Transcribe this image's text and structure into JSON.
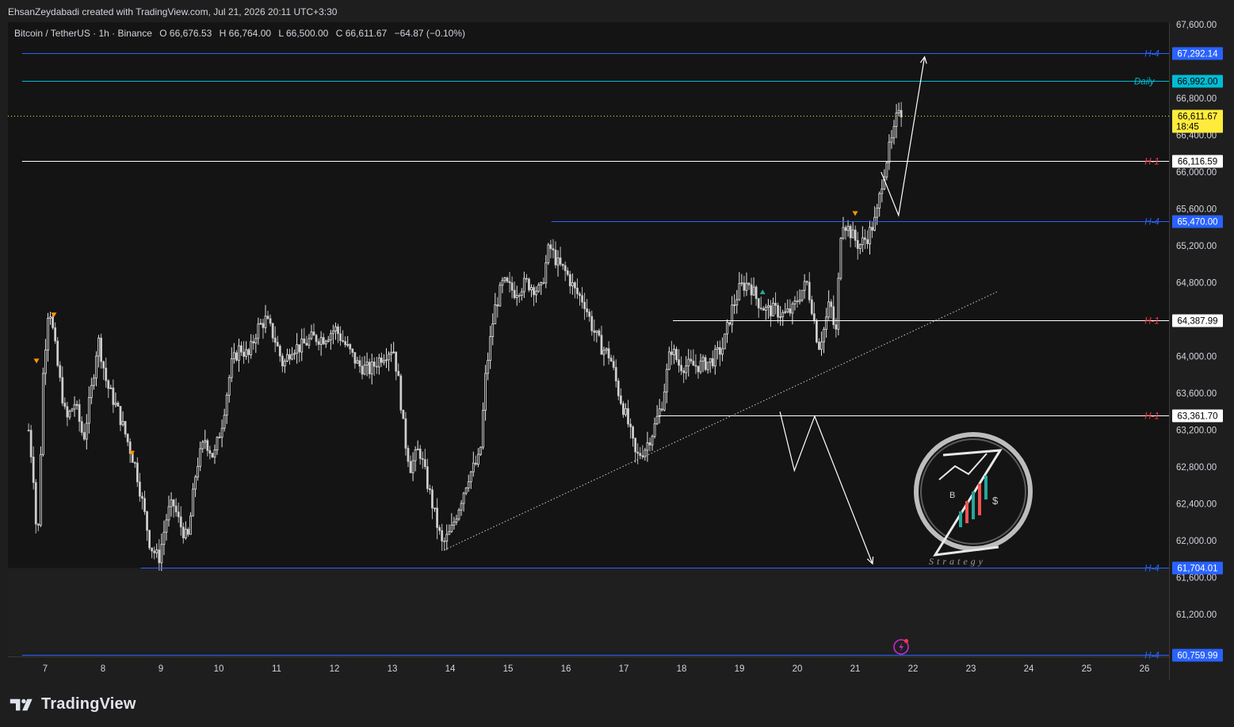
{
  "header": {
    "attribution": "EhsanZeydabadi created with TradingView.com, Jul 21, 2026 20:11 UTC+3:30"
  },
  "legend": {
    "symbol": "Bitcoin / TetherUS · 1h · Binance",
    "o_label": "O",
    "o_value": "66,676.53",
    "h_label": "H",
    "h_value": "66,764.00",
    "l_label": "L",
    "l_value": "66,500.00",
    "c_label": "C",
    "c_value": "66,611.67",
    "change": "−64.87 (−0.10%)"
  },
  "brand": {
    "name": "TradingView"
  },
  "watermark": {
    "caption": "Strategy"
  },
  "colors": {
    "background": "#141414",
    "price_bg": "#1e1e1e",
    "candle": "#d9d9d9",
    "h4_line": "#2962ff",
    "daily_line": "#00bcd4",
    "h1_line": "#ffffff",
    "h1_label": "#f23645",
    "current_price": "#ffeb3b",
    "marker_orange": "#ff9800",
    "marker_teal": "#26a69a"
  },
  "chart_data": {
    "type": "candlestick",
    "symbol": "Bitcoin / TetherUS",
    "interval": "1h",
    "exchange": "Binance",
    "x_axis": {
      "ticks": [
        {
          "label": "7",
          "day": 7
        },
        {
          "label": "8",
          "day": 8
        },
        {
          "label": "9",
          "day": 9
        },
        {
          "label": "10",
          "day": 10
        },
        {
          "label": "11",
          "day": 11
        },
        {
          "label": "12",
          "day": 12
        },
        {
          "label": "13",
          "day": 13
        },
        {
          "label": "14",
          "day": 14
        },
        {
          "label": "15",
          "day": 15
        },
        {
          "label": "16",
          "day": 16
        },
        {
          "label": "17",
          "day": 17
        },
        {
          "label": "18",
          "day": 18
        },
        {
          "label": "19",
          "day": 19
        },
        {
          "label": "20",
          "day": 20
        },
        {
          "label": "21",
          "day": 21
        },
        {
          "label": "22",
          "day": 22
        },
        {
          "label": "23",
          "day": 23
        },
        {
          "label": "24",
          "day": 24
        },
        {
          "label": "25",
          "day": 25
        },
        {
          "label": "26",
          "day": 26
        }
      ]
    },
    "y_axis": {
      "ticks": [
        {
          "label": "67,600.00",
          "value": 67600
        },
        {
          "label": "66,800.00",
          "value": 66800
        },
        {
          "label": "66,400.00",
          "value": 66400
        },
        {
          "label": "66,000.00",
          "value": 66000
        },
        {
          "label": "65,600.00",
          "value": 65600
        },
        {
          "label": "65,200.00",
          "value": 65200
        },
        {
          "label": "64,800.00",
          "value": 64800
        },
        {
          "label": "64,000.00",
          "value": 64000
        },
        {
          "label": "63,600.00",
          "value": 63600
        },
        {
          "label": "63,200.00",
          "value": 63200
        },
        {
          "label": "62,800.00",
          "value": 62800
        },
        {
          "label": "62,400.00",
          "value": 62400
        },
        {
          "label": "62,000.00",
          "value": 62000
        },
        {
          "label": "61,600.00",
          "value": 61600
        },
        {
          "label": "61,200.00",
          "value": 61200
        }
      ]
    },
    "price_path": [
      [
        6.7,
        63200
      ],
      [
        6.8,
        62600
      ],
      [
        6.85,
        61800
      ],
      [
        6.95,
        63800
      ],
      [
        7.05,
        64600
      ],
      [
        7.2,
        63900
      ],
      [
        7.35,
        63300
      ],
      [
        7.5,
        63500
      ],
      [
        7.65,
        63100
      ],
      [
        7.8,
        63700
      ],
      [
        7.9,
        64200
      ],
      [
        8.05,
        63700
      ],
      [
        8.25,
        63400
      ],
      [
        8.45,
        63000
      ],
      [
        8.55,
        62800
      ],
      [
        8.7,
        62300
      ],
      [
        8.8,
        61950
      ],
      [
        8.95,
        61800
      ],
      [
        9.1,
        62300
      ],
      [
        9.2,
        62400
      ],
      [
        9.3,
        62200
      ],
      [
        9.45,
        62000
      ],
      [
        9.6,
        62800
      ],
      [
        9.75,
        63100
      ],
      [
        9.9,
        62900
      ],
      [
        10.05,
        63300
      ],
      [
        10.2,
        63900
      ],
      [
        10.35,
        64100
      ],
      [
        10.5,
        64000
      ],
      [
        10.65,
        64300
      ],
      [
        10.8,
        64400
      ],
      [
        10.95,
        64200
      ],
      [
        11.1,
        63900
      ],
      [
        11.25,
        64100
      ],
      [
        11.4,
        64100
      ],
      [
        11.6,
        64200
      ],
      [
        11.8,
        64200
      ],
      [
        12.0,
        64300
      ],
      [
        12.2,
        64100
      ],
      [
        12.4,
        63900
      ],
      [
        12.6,
        63850
      ],
      [
        12.8,
        64000
      ],
      [
        13.0,
        64100
      ],
      [
        13.1,
        63700
      ],
      [
        13.2,
        63100
      ],
      [
        13.3,
        62800
      ],
      [
        13.45,
        63000
      ],
      [
        13.6,
        62600
      ],
      [
        13.75,
        62200
      ],
      [
        13.85,
        61950
      ],
      [
        14.0,
        62100
      ],
      [
        14.15,
        62400
      ],
      [
        14.3,
        62700
      ],
      [
        14.5,
        62900
      ],
      [
        14.6,
        63800
      ],
      [
        14.75,
        64500
      ],
      [
        14.9,
        64800
      ],
      [
        15.1,
        64700
      ],
      [
        15.3,
        64800
      ],
      [
        15.55,
        64700
      ],
      [
        15.7,
        65200
      ],
      [
        15.85,
        65000
      ],
      [
        16.0,
        64900
      ],
      [
        16.15,
        64700
      ],
      [
        16.3,
        64600
      ],
      [
        16.45,
        64300
      ],
      [
        16.6,
        64100
      ],
      [
        16.75,
        64000
      ],
      [
        16.9,
        63600
      ],
      [
        17.05,
        63300
      ],
      [
        17.2,
        62900
      ],
      [
        17.35,
        63000
      ],
      [
        17.5,
        63200
      ],
      [
        17.65,
        63500
      ],
      [
        17.8,
        64100
      ],
      [
        17.95,
        63900
      ],
      [
        18.1,
        63900
      ],
      [
        18.3,
        63900
      ],
      [
        18.5,
        63950
      ],
      [
        18.7,
        64100
      ],
      [
        18.85,
        64500
      ],
      [
        19.0,
        64750
      ],
      [
        19.15,
        64800
      ],
      [
        19.3,
        64600
      ],
      [
        19.45,
        64500
      ],
      [
        19.6,
        64500
      ],
      [
        19.75,
        64450
      ],
      [
        19.9,
        64500
      ],
      [
        20.05,
        64700
      ],
      [
        20.15,
        64800
      ],
      [
        20.25,
        64500
      ],
      [
        20.35,
        64100
      ],
      [
        20.45,
        64300
      ],
      [
        20.55,
        64600
      ],
      [
        20.65,
        64200
      ],
      [
        20.75,
        65500
      ],
      [
        20.85,
        65400
      ],
      [
        20.95,
        65300
      ],
      [
        21.05,
        65200
      ],
      [
        21.2,
        65300
      ],
      [
        21.35,
        65500
      ],
      [
        21.45,
        65900
      ],
      [
        21.55,
        66200
      ],
      [
        21.65,
        66400
      ],
      [
        21.75,
        66750
      ],
      [
        21.8,
        66611.67
      ]
    ],
    "levels": [
      {
        "label": "H-4",
        "value": 67292.14,
        "price_label": "67,292.14",
        "color": "#2962ff",
        "label_color": "#2962ff",
        "box_bg": "#2962ff",
        "box_fg": "#ffffff",
        "from_day": 6.6
      },
      {
        "label": "Daily",
        "value": 66992.0,
        "price_label": "66,992.00",
        "color": "#00bcd4",
        "label_color": "#00bcd4",
        "box_bg": "#00bcd4",
        "box_fg": "#000000",
        "from_day": 6.6
      },
      {
        "label": "H-1",
        "value": 66116.59,
        "price_label": "66,116.59",
        "color": "#ffffff",
        "label_color": "#f23645",
        "box_bg": "#ffffff",
        "box_fg": "#000000",
        "from_day": 6.6
      },
      {
        "label": "H-4",
        "value": 65470.0,
        "price_label": "65,470.00",
        "color": "#2962ff",
        "label_color": "#2962ff",
        "box_bg": "#2962ff",
        "box_fg": "#ffffff",
        "from_day": 15.75
      },
      {
        "label": "H-1",
        "value": 64387.99,
        "price_label": "64,387.99",
        "color": "#ffffff",
        "label_color": "#f23645",
        "box_bg": "#ffffff",
        "box_fg": "#000000",
        "from_day": 17.85
      },
      {
        "label": "H-1",
        "value": 63361.7,
        "price_label": "63,361.70",
        "color": "#ffffff",
        "label_color": "#f23645",
        "box_bg": "#ffffff",
        "box_fg": "#000000",
        "from_day": 17.6
      },
      {
        "label": "H-4",
        "value": 61704.01,
        "price_label": "61,704.01",
        "color": "#2962ff",
        "label_color": "#2962ff",
        "box_bg": "#2962ff",
        "box_fg": "#ffffff",
        "from_day": 8.65
      },
      {
        "label": "H-4",
        "value": 60759.99,
        "price_label": "60,759.99",
        "color": "#2962ff",
        "label_color": "#2962ff",
        "box_bg": "#2962ff",
        "box_fg": "#ffffff",
        "from_day": 6.6
      }
    ],
    "current_price": {
      "value": 66611.67,
      "price_label": "66,611.67",
      "countdown": "18:45"
    },
    "trendline": {
      "from": [
        13.9,
        61900
      ],
      "to": [
        23.45,
        64700
      ]
    },
    "projection_up": [
      [
        21.45,
        66000
      ],
      [
        21.75,
        65530
      ],
      [
        22.2,
        67250
      ]
    ],
    "projection_down": [
      [
        19.7,
        63400
      ],
      [
        19.95,
        62760
      ],
      [
        20.3,
        63350
      ],
      [
        21.3,
        61750
      ]
    ],
    "markers": [
      {
        "day": 6.85,
        "value": 63950,
        "color": "#ff9800",
        "shape": "down"
      },
      {
        "day": 7.15,
        "value": 64450,
        "color": "#ff9800",
        "shape": "down"
      },
      {
        "day": 8.5,
        "value": 62950,
        "color": "#ff9800",
        "shape": "down"
      },
      {
        "day": 19.4,
        "value": 64700,
        "color": "#26a69a",
        "shape": "up"
      },
      {
        "day": 21.0,
        "value": 65550,
        "color": "#ff9800",
        "shape": "down"
      }
    ]
  }
}
